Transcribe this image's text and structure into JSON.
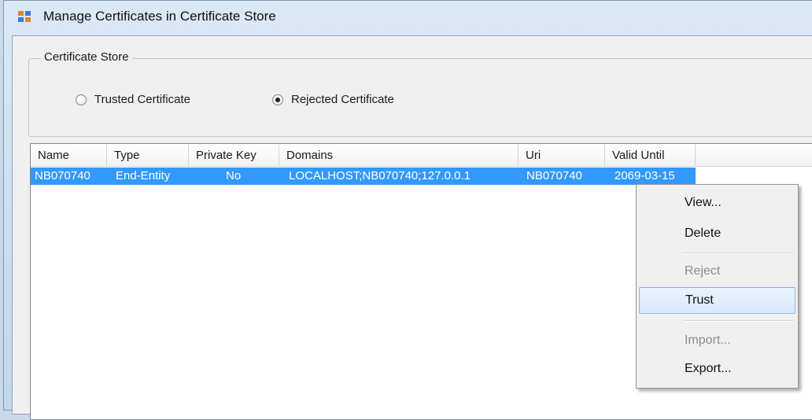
{
  "window": {
    "title": "Manage Certificates in Certificate Store"
  },
  "certificate_store": {
    "legend": "Certificate Store",
    "options": [
      {
        "label": "Trusted Certificate",
        "selected": false
      },
      {
        "label": "Rejected Certificate",
        "selected": true
      }
    ]
  },
  "table": {
    "columns": [
      "Name",
      "Type",
      "Private Key",
      "Domains",
      "Uri",
      "Valid Until"
    ],
    "rows": [
      {
        "name": "NB070740",
        "type": "End-Entity",
        "private_key": "No",
        "domains": "LOCALHOST;NB070740;127.0.0.1",
        "uri": "NB070740",
        "valid_until": "2069-03-15",
        "selected": true
      }
    ]
  },
  "context_menu": {
    "items": [
      {
        "label": "View...",
        "enabled": true
      },
      {
        "label": "Delete",
        "enabled": true
      },
      {
        "label": "Reject",
        "enabled": false
      },
      {
        "label": "Trust",
        "enabled": true,
        "hover": true
      },
      {
        "label": "Import...",
        "enabled": false
      },
      {
        "label": "Export...",
        "enabled": true
      }
    ]
  },
  "colors": {
    "selection": "#3399ff",
    "title_bar": "#c9d9ea"
  }
}
